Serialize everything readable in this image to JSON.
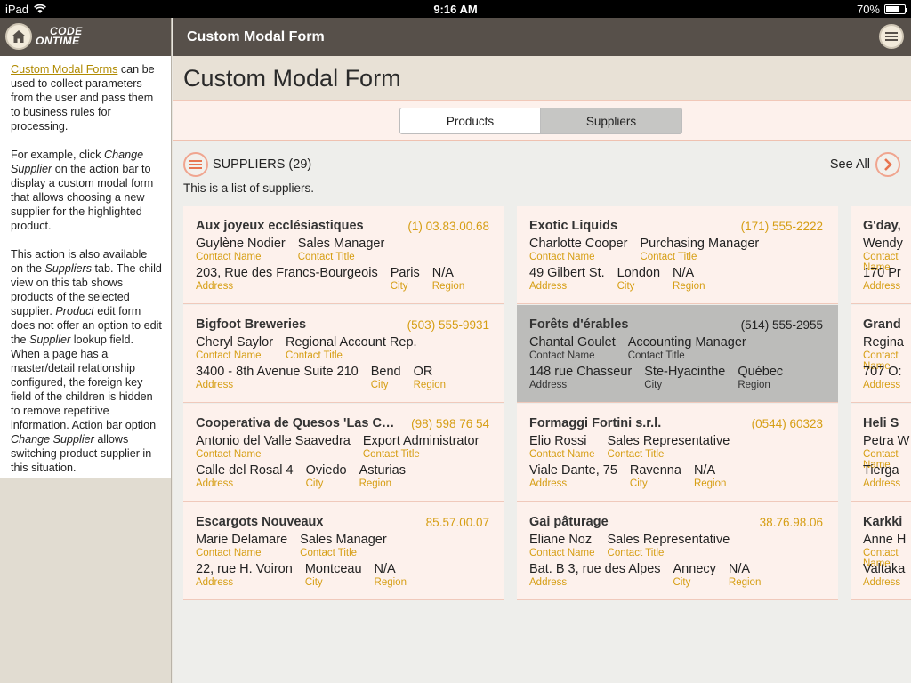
{
  "status": {
    "device": "iPad",
    "time": "9:16 AM",
    "battery": "70%"
  },
  "sidebar": {
    "logo_line1": "CODE",
    "logo_line2": "ONTIME",
    "link": "Custom Modal Forms",
    "p1_rest": " can be used to collect parameters from the user and pass them to business rules for processing.",
    "p2_a": "For example, click ",
    "p2_em1": "Change Supplier",
    "p2_b": " on the action bar to display a custom modal form that allows choosing a new supplier for the highlighted product.",
    "p3_a": "This action is also available on the ",
    "p3_em1": "Suppliers",
    "p3_b": " tab. The child view on this tab shows products of the selected supplier. ",
    "p3_em2": "Product",
    "p3_c": " edit form does not offer an option to edit the ",
    "p3_em3": "Supplier",
    "p3_d": " lookup field. When a page has a master/detail relationship configured, the foreign key field of the children is hidden to remove repetitive information. Action bar option ",
    "p3_em4": "Change Supplier",
    "p3_e": " allows switching product supplier in this situation."
  },
  "topbar": {
    "title": "Custom Modal Form"
  },
  "page": {
    "title": "Custom Modal Form"
  },
  "tabs": [
    {
      "label": "Products"
    },
    {
      "label": "Suppliers"
    }
  ],
  "view": {
    "title": "SUPPLIERS (29)",
    "see_all": "See All",
    "description": "This is a list of suppliers."
  },
  "labels": {
    "contact_name": "Contact Name",
    "contact_title": "Contact Title",
    "address": "Address",
    "city": "City",
    "region": "Region"
  },
  "cards": [
    {
      "name": "Aux joyeux ecclésiastiques",
      "phone": "(1) 03.83.00.68",
      "contact": "Guylène Nodier",
      "title": "Sales Manager",
      "address": "203, Rue des Francs-Bourgeois",
      "city": "Paris",
      "region": "N/A"
    },
    {
      "name": "Exotic Liquids",
      "phone": "(171) 555-2222",
      "contact": "Charlotte Cooper",
      "title": "Purchasing Manager",
      "address": "49 Gilbert St.",
      "city": "London",
      "region": "N/A"
    },
    {
      "name": "G'day,",
      "phone": "",
      "contact": "Wendy",
      "title": "",
      "address": "170 Pr",
      "city": "",
      "region": ""
    },
    {
      "name": "Bigfoot Breweries",
      "phone": "(503) 555-9931",
      "contact": "Cheryl Saylor",
      "title": "Regional Account Rep.",
      "address": "3400 - 8th Avenue Suite 210",
      "city": "Bend",
      "region": "OR"
    },
    {
      "name": "Forêts d'érables",
      "phone": "(514) 555-2955",
      "contact": "Chantal Goulet",
      "title": "Accounting Manager",
      "address": "148 rue Chasseur",
      "city": "Ste-Hyacinthe",
      "region": "Québec"
    },
    {
      "name": "Grand",
      "phone": "",
      "contact": "Regina",
      "title": "",
      "address": "707 O:",
      "city": "",
      "region": ""
    },
    {
      "name": "Cooperativa de Quesos 'Las C…",
      "phone": "(98) 598 76 54",
      "contact": "Antonio del Valle Saavedra",
      "title": "Export Administrator",
      "address": "Calle del Rosal 4",
      "city": "Oviedo",
      "region": "Asturias"
    },
    {
      "name": "Formaggi Fortini s.r.l.",
      "phone": "(0544) 60323",
      "contact": "Elio Rossi",
      "title": "Sales Representative",
      "address": "Viale Dante, 75",
      "city": "Ravenna",
      "region": "N/A"
    },
    {
      "name": "Heli S",
      "phone": "",
      "contact": "Petra W",
      "title": "",
      "address": "Tierga",
      "city": "",
      "region": ""
    },
    {
      "name": "Escargots Nouveaux",
      "phone": "85.57.00.07",
      "contact": "Marie Delamare",
      "title": "Sales Manager",
      "address": "22, rue H. Voiron",
      "city": "Montceau",
      "region": "N/A"
    },
    {
      "name": "Gai pâturage",
      "phone": "38.76.98.06",
      "contact": "Eliane Noz",
      "title": "Sales Representative",
      "address": "Bat. B 3, rue des Alpes",
      "city": "Annecy",
      "region": "N/A"
    },
    {
      "name": "Karkki",
      "phone": "",
      "contact": "Anne H",
      "title": "",
      "address": "Valtaka",
      "city": "",
      "region": ""
    }
  ],
  "colors": {
    "header": "#57504a",
    "accent": "#d69e14",
    "card": "#fdf1ec",
    "selected": "#bcbcba"
  }
}
